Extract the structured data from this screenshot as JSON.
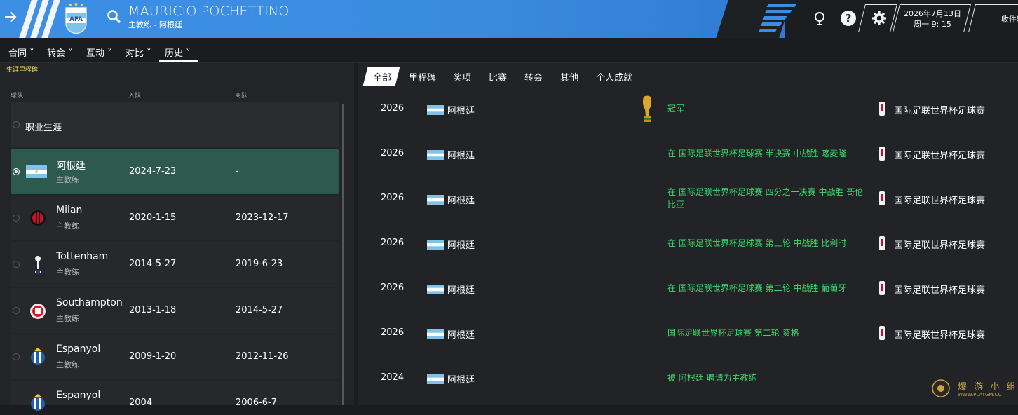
{
  "header": {
    "manager_name": "MAURICIO POCHETTINO",
    "manager_subtitle": "主教练 - 阿根廷",
    "date_line1": "2026年7月13日",
    "date_line2": "周一 9: 15",
    "inbox_label": "收件箱",
    "help_icon": "question-icon",
    "settings_icon": "gear-icon",
    "accent_color": "#3d8fe6"
  },
  "subnav": {
    "items": [
      "合同",
      "转会",
      "互动",
      "对比",
      "历史"
    ],
    "active": "历史"
  },
  "career": {
    "section_label": "生涯里程碑",
    "columns": [
      "球队",
      "入队",
      "离队"
    ],
    "header_label": "职业生涯",
    "rows": [
      {
        "club": "阿根廷",
        "role": "主教练",
        "joined": "2024-7-23",
        "left": "-",
        "selected": true
      },
      {
        "club": "Milan",
        "role": "主教练",
        "joined": "2020-1-15",
        "left": "2023-12-17",
        "selected": false
      },
      {
        "club": "Tottenham",
        "role": "主教练",
        "joined": "2014-5-27",
        "left": "2019-6-23",
        "selected": false
      },
      {
        "club": "Southampton",
        "role": "主教练",
        "joined": "2013-1-18",
        "left": "2014-5-27",
        "selected": false
      },
      {
        "club": "Espanyol",
        "role": "主教练",
        "joined": "2009-1-20",
        "left": "2012-11-26",
        "selected": false
      },
      {
        "club": "Espanyol",
        "role": "主教练",
        "joined": "2004",
        "left": "2006-6-7",
        "selected": false
      }
    ]
  },
  "history": {
    "tabs": [
      "全部",
      "里程碑",
      "奖项",
      "比赛",
      "转会",
      "其他",
      "个人成就"
    ],
    "active_tab": "全部",
    "rows": [
      {
        "year": "2026",
        "nation": "阿根廷",
        "desc": "冠军",
        "competition": "国际足联世界杯足球赛",
        "trophy": true
      },
      {
        "year": "2026",
        "nation": "阿根廷",
        "desc": "在 国际足联世界杯足球赛 半决赛 中战胜 喀麦隆",
        "competition": "国际足联世界杯足球赛",
        "trophy": false
      },
      {
        "year": "2026",
        "nation": "阿根廷",
        "desc": "在 国际足联世界杯足球赛 四分之一决赛 中战胜 哥伦比亚",
        "competition": "国际足联世界杯足球赛",
        "trophy": false
      },
      {
        "year": "2026",
        "nation": "阿根廷",
        "desc": "在 国际足联世界杯足球赛 第三轮 中战胜 比利时",
        "competition": "国际足联世界杯足球赛",
        "trophy": false
      },
      {
        "year": "2026",
        "nation": "阿根廷",
        "desc": "在 国际足联世界杯足球赛 第二轮 中战胜 葡萄牙",
        "competition": "国际足联世界杯足球赛",
        "trophy": false
      },
      {
        "year": "2026",
        "nation": "阿根廷",
        "desc": "国际足联世界杯足球赛 第二轮 资格",
        "competition": "国际足联世界杯足球赛",
        "trophy": false
      },
      {
        "year": "2024",
        "nation": "阿根廷",
        "desc": "被 阿根廷 聘请为主教练",
        "competition": "",
        "trophy": false
      }
    ]
  },
  "watermark": {
    "text": "爆 游 小 组",
    "sub": "WWW.PLAYGM.CC"
  }
}
